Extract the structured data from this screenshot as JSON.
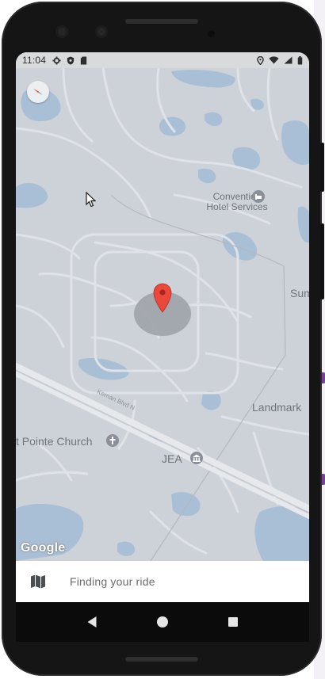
{
  "status_bar": {
    "time": "11:04",
    "left_icons": [
      "settings-icon",
      "shield-icon",
      "sim-card-icon"
    ],
    "right_icons": [
      "location-icon",
      "wifi-icon",
      "signal-icon",
      "battery-icon"
    ]
  },
  "map": {
    "labels": {
      "convention": "Convention\nHotel Services",
      "landmark": "Landmark",
      "church": "t Pointe Church",
      "jea": "JEA",
      "sum": "Sum",
      "road": "Kernan Blvd N"
    },
    "google_logo": "Google",
    "marker_color": "#e9483a",
    "accuracy_circle_color": "#9ea2a8",
    "water_color": "#a9bfd6",
    "land_color": "#cdd2d9",
    "road_color": "#dfe2e7"
  },
  "bottom_panel": {
    "icon": "map-icon",
    "status_text": "Finding your ride"
  },
  "nav_bar": {
    "back": "back-icon",
    "home": "home-icon",
    "recents": "recents-icon"
  }
}
